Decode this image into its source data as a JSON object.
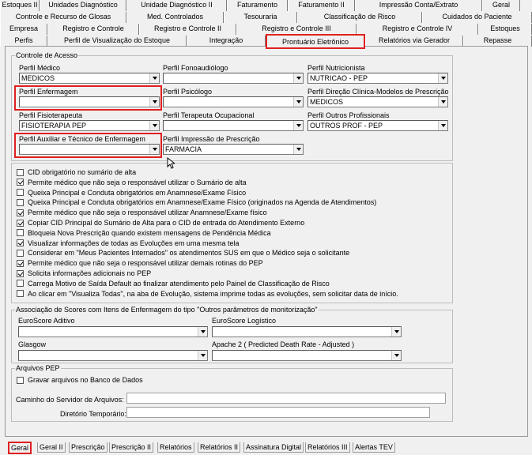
{
  "top_tabs": {
    "row1": [
      "Estoques II",
      "Unidades Diagnóstico",
      "Unidade Diagnóstico II",
      "Faturamento",
      "Faturamento II",
      "Impressão Conta/Extrato",
      "Geral"
    ],
    "row2": [
      "Controle e Recurso de Glosas",
      "Med. Controlados",
      "Tesouraria",
      "Classificação de Risco",
      "Cuidados do Paciente"
    ],
    "row3": [
      "Empresa",
      "Registro e Controle",
      "Registro e Controle II",
      "Registro e Controle III",
      "Registro e Controle IV",
      "Estoques"
    ],
    "row4": [
      "Perfis",
      "Perfil de Visualização do Estoque",
      "Integração",
      "Prontuário Eletrônico",
      "Relatórios via Gerador",
      "Repasse"
    ]
  },
  "controle_acesso": {
    "legend": "Controle de Acesso",
    "fields": [
      {
        "label": "Perfil Médico",
        "value": "MEDICOS"
      },
      {
        "label": "Perfil Fonoaudiólogo",
        "value": ""
      },
      {
        "label": "Perfil Nutricionista",
        "value": "NUTRICAO - PEP"
      },
      {
        "label": "Perfil Enfermagem",
        "value": ""
      },
      {
        "label": "Perfil Psicólogo",
        "value": ""
      },
      {
        "label": "Perfil Direção Clínica-Modelos de Prescrição",
        "value": "MEDICOS"
      },
      {
        "label": "Perfil Fisioterapeuta",
        "value": "FISIOTERAPIA PEP"
      },
      {
        "label": "Perfil Terapeuta Ocupacional",
        "value": ""
      },
      {
        "label": "Perfil Outros Profissionais",
        "value": "OUTROS PROF - PEP"
      },
      {
        "label": "Perfil Auxiliar e Técnico de Enfermagem",
        "value": ""
      },
      {
        "label": "Perfil Impressão de Prescrição",
        "value": "FARMACIA"
      }
    ]
  },
  "options": [
    {
      "label": "CID obrigatório no sumário de alta",
      "checked": false
    },
    {
      "label": "Permite médico que não seja o responsável utilizar o Sumário de alta",
      "checked": true
    },
    {
      "label": "Queixa Principal e Conduta obrigatórios em Anamnese/Exame Físico",
      "checked": false
    },
    {
      "label": "Queixa Principal e Conduta obrigatórios em Anamnese/Exame Físico (originados na Agenda de Atendimentos)",
      "checked": false
    },
    {
      "label": "Permite médico que não seja o responsável utilizar Anamnese/Exame físico",
      "checked": true
    },
    {
      "label": "Copiar CID Principal do Sumário de Alta para o CID de entrada do Atendimento Externo",
      "checked": true
    },
    {
      "label": "Bloqueia Nova Prescrição quando existem mensagens de Pendência Médica",
      "checked": false
    },
    {
      "label": "Visualizar informações de todas as Evoluções em uma mesma tela",
      "checked": true
    },
    {
      "label": "Considerar em \"Meus Pacientes Internados\" os atendimentos SUS em que o Médico seja o solicitante",
      "checked": false
    },
    {
      "label": "Permite médico que não seja o responsável utilizar demais rotinas do PEP",
      "checked": true
    },
    {
      "label": "Solicita informações adicionais no PEP",
      "checked": true
    },
    {
      "label": "Carrega Motivo de Saída Default ao finalizar atendimento pelo Painel de Classificação de Risco",
      "checked": false
    },
    {
      "label": "Ao clicar em \"Visualiza Todas\", na aba de Evolução, sistema imprime todas as evoluções, sem solicitar data de início.",
      "checked": false
    }
  ],
  "scores": {
    "legend": "Associação de Scores com Itens de Enfermagem do tipo \"Outros parâmetros de monitorização\"",
    "fields": [
      {
        "label": "EuroScore Aditivo",
        "value": ""
      },
      {
        "label": "EuroScore Logístico",
        "value": ""
      },
      {
        "label": "Glasgow",
        "value": ""
      },
      {
        "label": "Apache 2 ( Predicted Death Rate - Adjusted )",
        "value": ""
      }
    ]
  },
  "arquivos": {
    "legend": "Arquivos PEP",
    "gravar_label": "Gravar arquivos no Banco de Dados",
    "caminho_label": "Caminho do Servidor de Arquivos:",
    "caminho_value": "",
    "temp_label": "Diretório Temporário:",
    "temp_value": ""
  },
  "bottom_tabs": [
    "Geral",
    "Geral II",
    "Prescrição",
    "Prescrição II",
    "Relatórios",
    "Relatórios II",
    "Assinatura Digital",
    "Relatórios III",
    "Alertas TEV"
  ]
}
